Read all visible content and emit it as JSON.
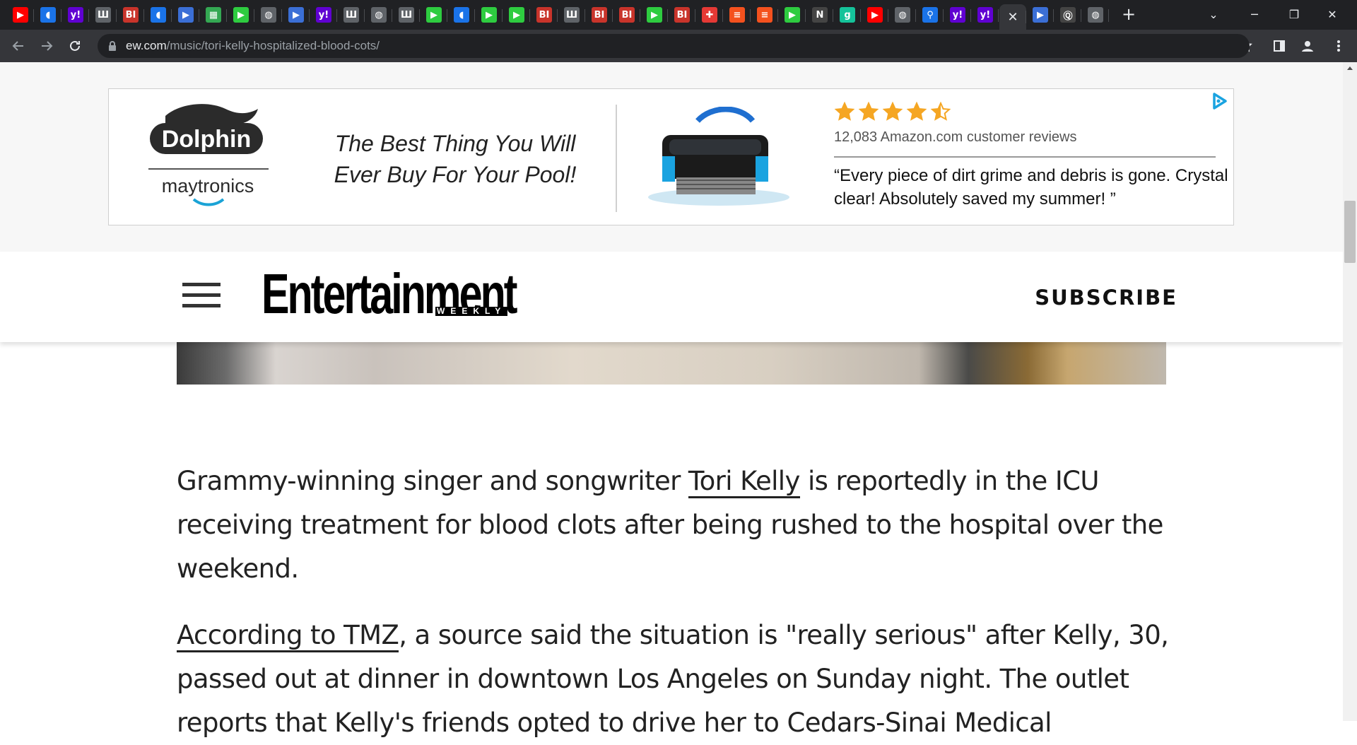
{
  "browser": {
    "url_host": "ew.com",
    "url_path": "/music/tori-kelly-hospitalized-blood-cots/",
    "tab_close_glyph": "✕",
    "new_tab_glyph": "+",
    "tabs": [
      {
        "icon": "youtube-icon",
        "color": "#ff0000",
        "glyph": "▶"
      },
      {
        "icon": "shield-icon",
        "color": "#1a73e8",
        "glyph": "◖"
      },
      {
        "icon": "yahoo-icon",
        "color": "#6001d2",
        "glyph": "y!"
      },
      {
        "icon": "slash-icon",
        "color": "#5f6368",
        "glyph": "Ш"
      },
      {
        "icon": "business-insider-icon",
        "color": "#c9342b",
        "glyph": "BI"
      },
      {
        "icon": "shield-icon",
        "color": "#1a73e8",
        "glyph": "◖"
      },
      {
        "icon": "arrow-icon",
        "color": "#3b6fd6",
        "glyph": "▶"
      },
      {
        "icon": "grid-icon",
        "color": "#34a853",
        "glyph": "▦"
      },
      {
        "icon": "play-icon",
        "color": "#2ecc40",
        "glyph": "▶"
      },
      {
        "icon": "globe-icon",
        "color": "#5f6368",
        "glyph": "◍"
      },
      {
        "icon": "arrow-icon",
        "color": "#3b6fd6",
        "glyph": "▶"
      },
      {
        "icon": "yahoo-icon",
        "color": "#6001d2",
        "glyph": "y!"
      },
      {
        "icon": "slash-icon",
        "color": "#5f6368",
        "glyph": "Ш"
      },
      {
        "icon": "globe-icon",
        "color": "#5f6368",
        "glyph": "◍"
      },
      {
        "icon": "slash-icon",
        "color": "#5f6368",
        "glyph": "Ш"
      },
      {
        "icon": "play-icon",
        "color": "#2ecc40",
        "glyph": "▶"
      },
      {
        "icon": "shield-icon",
        "color": "#1a73e8",
        "glyph": "◖"
      },
      {
        "icon": "play-icon",
        "color": "#2ecc40",
        "glyph": "▶"
      },
      {
        "icon": "play-icon",
        "color": "#2ecc40",
        "glyph": "▶"
      },
      {
        "icon": "business-insider-icon",
        "color": "#c9342b",
        "glyph": "BI"
      },
      {
        "icon": "slash-icon",
        "color": "#5f6368",
        "glyph": "Ш"
      },
      {
        "icon": "business-insider-icon",
        "color": "#c9342b",
        "glyph": "BI"
      },
      {
        "icon": "business-insider-icon",
        "color": "#c9342b",
        "glyph": "BI"
      },
      {
        "icon": "play-icon",
        "color": "#2ecc40",
        "glyph": "▶"
      },
      {
        "icon": "business-insider-icon",
        "color": "#c9342b",
        "glyph": "BI"
      },
      {
        "icon": "pin-icon",
        "color": "#e53935",
        "glyph": "✚"
      },
      {
        "icon": "bookmark-icon",
        "color": "#f4511e",
        "glyph": "≡"
      },
      {
        "icon": "bookmark-icon",
        "color": "#f4511e",
        "glyph": "≡"
      },
      {
        "icon": "play-icon",
        "color": "#2ecc40",
        "glyph": "▶"
      },
      {
        "icon": "news-icon",
        "color": "#444444",
        "glyph": "N"
      },
      {
        "icon": "grammarly-icon",
        "color": "#15c39a",
        "glyph": "g"
      },
      {
        "icon": "youtube-icon",
        "color": "#ff0000",
        "glyph": "▶"
      },
      {
        "icon": "globe-icon",
        "color": "#5f6368",
        "glyph": "◍"
      },
      {
        "icon": "search-icon",
        "color": "#1a73e8",
        "glyph": "⚲"
      },
      {
        "icon": "yahoo-icon",
        "color": "#6001d2",
        "glyph": "y!"
      },
      {
        "icon": "yahoo-icon",
        "color": "#6001d2",
        "glyph": "y!"
      },
      {
        "icon": "close-icon",
        "color": "#35363a",
        "glyph": "✕",
        "active": true
      },
      {
        "icon": "arrow-icon",
        "color": "#3b6fd6",
        "glyph": "▶"
      },
      {
        "icon": "news-icon",
        "color": "#444444",
        "glyph": "Ⓠ"
      },
      {
        "icon": "globe-icon",
        "color": "#5f6368",
        "glyph": "◍"
      }
    ]
  },
  "ad": {
    "brand": "Dolphin",
    "maker": "maytronics",
    "tagline": "The Best Thing You Will Ever Buy For Your Pool!",
    "rating_stars": 4.5,
    "reviews": "12,083 Amazon.com customer reviews",
    "quote": "“Every piece of dirt grime and debris is gone. Crystal clear! Absolutely saved my summer! ”",
    "star_color": "#f5a623"
  },
  "site": {
    "logo": "Entertainment",
    "logo_sub": "WEEKLY",
    "subscribe": "SUBSCRIBE"
  },
  "article": {
    "p1_before": "Grammy-winning singer and songwriter ",
    "p1_link": "Tori Kelly",
    "p1_after": " is reportedly in the ICU receiving treatment for blood clots after being rushed to the hospital over the weekend.",
    "p2_link": "According to TMZ",
    "p2_after": ", a source said the situation is \"really serious\" after Kelly, 30, passed out at dinner in downtown Los Angeles on Sunday night. The outlet reports that Kelly's friends opted to drive her to Cedars-Sinai Medical"
  }
}
